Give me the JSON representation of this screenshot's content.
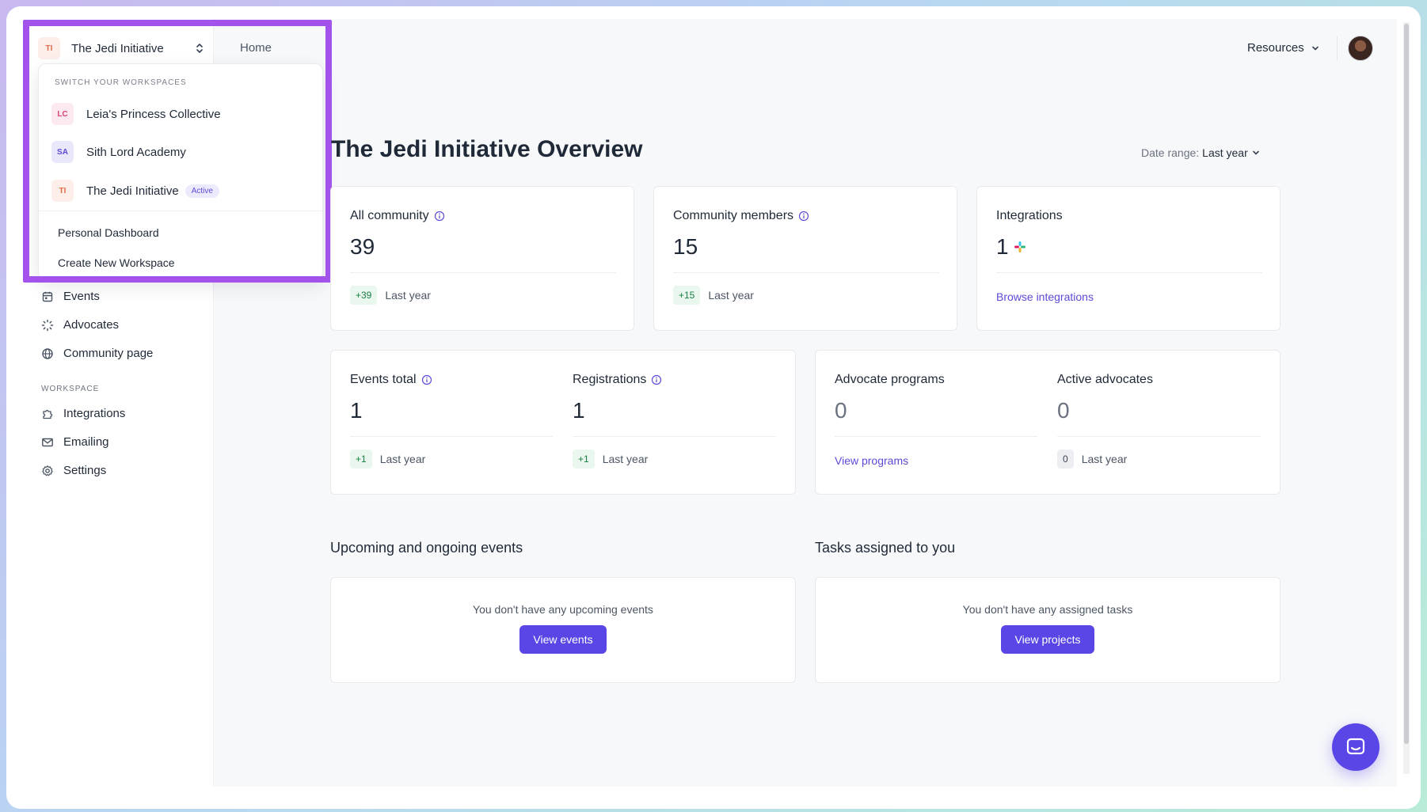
{
  "workspace": {
    "current_initials": "TI",
    "current_name": "The Jedi Initiative"
  },
  "topbar": {
    "home": "Home",
    "resources": "Resources"
  },
  "dropdown": {
    "heading": "SWITCH YOUR WORKSPACES",
    "workspaces": [
      {
        "initials": "LC",
        "name": "Leia's Princess Collective"
      },
      {
        "initials": "SA",
        "name": "Sith Lord Academy"
      },
      {
        "initials": "TI",
        "name": "The Jedi Initiative",
        "badge": "Active"
      }
    ],
    "personal_dashboard": "Personal Dashboard",
    "create_workspace": "Create New Workspace"
  },
  "sidebar": {
    "items": [
      {
        "label": "Events",
        "icon": "calendar-icon"
      },
      {
        "label": "Advocates",
        "icon": "spinner-icon"
      },
      {
        "label": "Community page",
        "icon": "globe-icon"
      }
    ],
    "workspace_label": "WORKSPACE",
    "workspace_items": [
      {
        "label": "Integrations",
        "icon": "puzzle-icon"
      },
      {
        "label": "Emailing",
        "icon": "mail-icon"
      },
      {
        "label": "Settings",
        "icon": "gear-icon"
      }
    ]
  },
  "page": {
    "title": "The Jedi Initiative Overview",
    "date_range_label": "Date range:",
    "date_range_value": "Last year"
  },
  "stats": {
    "all_community": {
      "label": "All community",
      "value": "39",
      "delta": "+39",
      "period": "Last year"
    },
    "community_members": {
      "label": "Community members",
      "value": "15",
      "delta": "+15",
      "period": "Last year"
    },
    "integrations": {
      "label": "Integrations",
      "value": "1",
      "link": "Browse integrations"
    },
    "events_total": {
      "label": "Events total",
      "value": "1",
      "delta": "+1",
      "period": "Last year"
    },
    "registrations": {
      "label": "Registrations",
      "value": "1",
      "delta": "+1",
      "period": "Last year"
    },
    "advocate_programs": {
      "label": "Advocate programs",
      "value": "0",
      "link": "View programs"
    },
    "active_advocates": {
      "label": "Active advocates",
      "value": "0",
      "delta": "0",
      "period": "Last year"
    }
  },
  "events_section": {
    "title": "Upcoming and ongoing events",
    "empty": "You don't have any upcoming events",
    "button": "View events"
  },
  "tasks_section": {
    "title": "Tasks assigned to you",
    "empty": "You don't have any assigned tasks",
    "button": "View projects"
  },
  "colors": {
    "accent": "#5a45e6",
    "highlight": "#a352ec",
    "delta_bg": "#eaf7ee",
    "delta_text": "#1a7f45"
  }
}
